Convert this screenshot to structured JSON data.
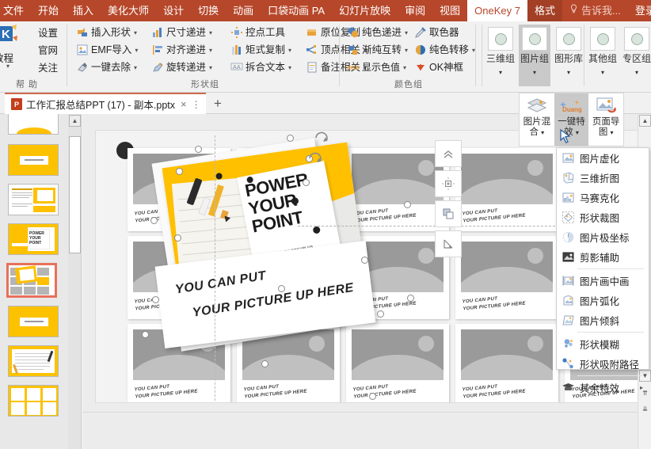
{
  "menubar": {
    "items": [
      {
        "label": "文件",
        "state": "first"
      },
      {
        "label": "开始",
        "state": "normal"
      },
      {
        "label": "插入",
        "state": "normal"
      },
      {
        "label": "美化大师",
        "state": "normal"
      },
      {
        "label": "设计",
        "state": "normal"
      },
      {
        "label": "切换",
        "state": "normal"
      },
      {
        "label": "动画",
        "state": "normal"
      },
      {
        "label": "口袋动画 PA",
        "state": "normal"
      },
      {
        "label": "幻灯片放映",
        "state": "normal"
      },
      {
        "label": "审阅",
        "state": "normal"
      },
      {
        "label": "视图",
        "state": "normal"
      },
      {
        "label": "OneKey 7",
        "state": "active-white"
      },
      {
        "label": "格式",
        "state": "active-dark"
      },
      {
        "label": "告诉我...",
        "state": "dim"
      },
      {
        "label": "登录",
        "state": "normal"
      }
    ],
    "tellme_icon": "lightbulb-icon",
    "accent_color": "#b7472a",
    "active_tab": "OneKey 7"
  },
  "ribbon": {
    "help_group": {
      "label": "帮 助",
      "tutorial": "教程",
      "items": [
        "设置",
        "官网",
        "关注"
      ]
    },
    "shape_group": {
      "label": "形状组",
      "rows": [
        [
          {
            "label": "插入形状",
            "icon": "insert-shape-icon",
            "arrow": true
          },
          {
            "label": "尺寸递进",
            "icon": "size-step-icon",
            "arrow": true
          },
          {
            "label": "控点工具",
            "icon": "handle-tool-icon",
            "arrow": false
          },
          {
            "label": "原位复制",
            "icon": "copy-inplace-icon",
            "arrow": false
          }
        ],
        [
          {
            "label": "EMF导入",
            "icon": "emf-import-icon",
            "arrow": true
          },
          {
            "label": "对齐递进",
            "icon": "align-step-icon",
            "arrow": true
          },
          {
            "label": "矩式复制",
            "icon": "matrix-copy-icon",
            "arrow": true
          },
          {
            "label": "顶点相关",
            "icon": "vertex-related-icon",
            "arrow": true
          }
        ],
        [
          {
            "label": "一键去除",
            "icon": "onekey-remove-icon",
            "arrow": true
          },
          {
            "label": "旋转递进",
            "icon": "rotate-step-icon",
            "arrow": true
          },
          {
            "label": "拆合文本",
            "icon": "split-text-icon",
            "arrow": true
          },
          {
            "label": "备注相关",
            "icon": "notes-related-icon",
            "arrow": true
          }
        ]
      ]
    },
    "color_group": {
      "label": "颜色组",
      "rows": [
        [
          {
            "label": "纯色递进",
            "icon": "solid-step-icon",
            "arrow": true
          },
          {
            "label": "取色器",
            "icon": "eyedropper-icon",
            "arrow": false
          }
        ],
        [
          {
            "label": "渐纯互转",
            "icon": "gradient-swap-icon",
            "arrow": true
          },
          {
            "label": "纯色转移",
            "icon": "color-transfer-icon",
            "arrow": true
          }
        ],
        [
          {
            "label": "显示色值",
            "icon": "rgb-value-icon",
            "arrow": true
          },
          {
            "label": "OK神框",
            "icon": "ok-frame-icon",
            "arrow": false
          }
        ]
      ]
    },
    "galleries": [
      {
        "label": "三维组",
        "icon": "gallery-circle-icon",
        "selected": false
      },
      {
        "label": "图片组",
        "icon": "gallery-circle-icon",
        "selected": true
      },
      {
        "label": "图形库",
        "icon": "gallery-circle-icon",
        "selected": false
      },
      {
        "label": "其他组",
        "icon": "gallery-circle-icon",
        "selected": false
      },
      {
        "label": "专区组",
        "icon": "gallery-circle-icon",
        "selected": false
      }
    ]
  },
  "tabstrip": {
    "document": {
      "icon": "powerpoint-file-icon",
      "title": "工作汇报总结PPT (17) - 副本.pptx",
      "close": "×",
      "menu": "⋮"
    },
    "new_tab": "+"
  },
  "command_flyout": {
    "buttons": [
      {
        "label": "图片混合",
        "icon": "image-blend-icon",
        "arrow": "▾",
        "selected": false
      },
      {
        "label": "一键特效",
        "icon": "duang-effect-icon",
        "arrow": "▾",
        "selected": true,
        "badge": "Duang"
      },
      {
        "label": "页面导图",
        "icon": "page-map-icon",
        "arrow": "▾",
        "selected": false
      }
    ]
  },
  "dropdown": {
    "name": "一键特效",
    "items": [
      {
        "label": "图片虚化",
        "icon": "image-blur-icon",
        "sep_after": false
      },
      {
        "label": "三维折图",
        "icon": "3d-fold-icon",
        "sep_after": false
      },
      {
        "label": "马赛克化",
        "icon": "mosaic-icon",
        "sep_after": false
      },
      {
        "label": "形状裁图",
        "icon": "shape-crop-icon",
        "sep_after": false
      },
      {
        "label": "图片极坐标",
        "icon": "polar-coord-icon",
        "sep_after": false
      },
      {
        "label": "剪影辅助",
        "icon": "silhouette-icon",
        "sep_after": true
      },
      {
        "label": "图片画中画",
        "icon": "picture-in-picture-icon",
        "sep_after": false
      },
      {
        "label": "图片弧化",
        "icon": "image-arc-icon",
        "sep_after": false
      },
      {
        "label": "图片倾斜",
        "icon": "image-skew-icon",
        "sep_after": true
      },
      {
        "label": "形状模糊",
        "icon": "shape-blur-icon",
        "sep_after": false
      },
      {
        "label": "形状吸附路径",
        "icon": "shape-snap-path-icon",
        "sep_after": true
      },
      {
        "label": "其余特效",
        "icon": "more-effects-icon",
        "submenu": "▸",
        "sep_after": false
      }
    ]
  },
  "canvas": {
    "poster": {
      "title_lines": [
        "POWER",
        "YOUR",
        "POINT"
      ],
      "subtitle": "PRESENTED BY ORKUPLUS",
      "banner_lines": [
        "YOU CAN PUT",
        "YOUR PICTURE UP HERE"
      ]
    },
    "grid_caption_lines": [
      "YOU CAN PUT",
      "YOUR PICTURE UP HERE"
    ],
    "mini_toolbar": [
      {
        "icon": "collapse-up-icon"
      },
      {
        "icon": "align-center-icon"
      },
      {
        "icon": "bring-forward-icon"
      },
      {
        "icon": "resize-diagonal-icon"
      }
    ]
  },
  "slide_panel": {
    "selected_index": 4,
    "thumbnails": [
      {
        "kind": "point-top"
      },
      {
        "kind": "yellow-title"
      },
      {
        "kind": "text-layout"
      },
      {
        "kind": "power-your-point"
      },
      {
        "kind": "grid-gallery"
      },
      {
        "kind": "yellow-title"
      },
      {
        "kind": "lined-notes"
      },
      {
        "kind": "triple-card"
      }
    ]
  },
  "scroll": {
    "up": "▲",
    "down": "▼",
    "prev_page": "⇈",
    "next_page": "⇊"
  }
}
